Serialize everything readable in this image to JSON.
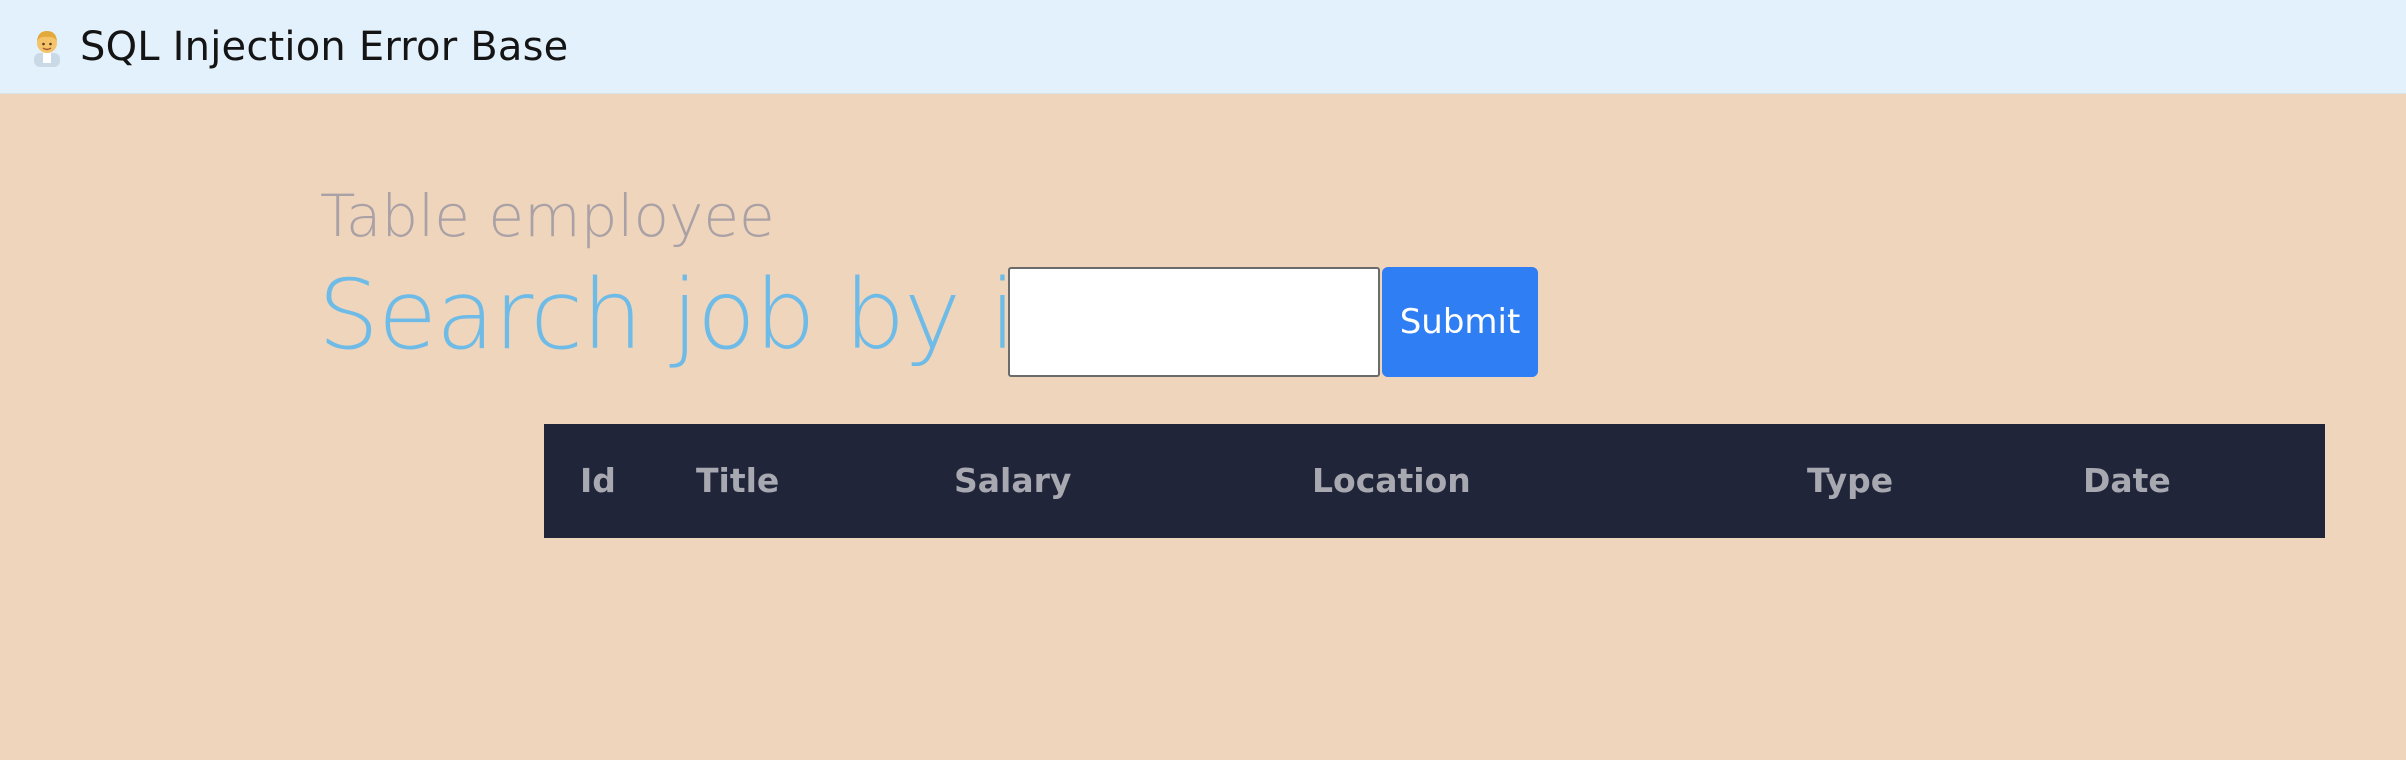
{
  "app": {
    "title": "SQL Injection Error Base",
    "logo_icon": "man-technologist-icon"
  },
  "page": {
    "subtitle": "Table employee",
    "heading": "Search job by id"
  },
  "search": {
    "value": "",
    "placeholder": "",
    "submit_label": "Submit"
  },
  "table": {
    "columns": [
      "Id",
      "Title",
      "Salary",
      "Location",
      "Type",
      "Date"
    ],
    "rows": []
  },
  "colors": {
    "background": "#efd5bb",
    "topbar": "#e2f1fc",
    "heading": "#6fbbe8",
    "subtitle": "#aaa1a6",
    "button": "#2f7ef3",
    "table_header": "#21253a"
  }
}
